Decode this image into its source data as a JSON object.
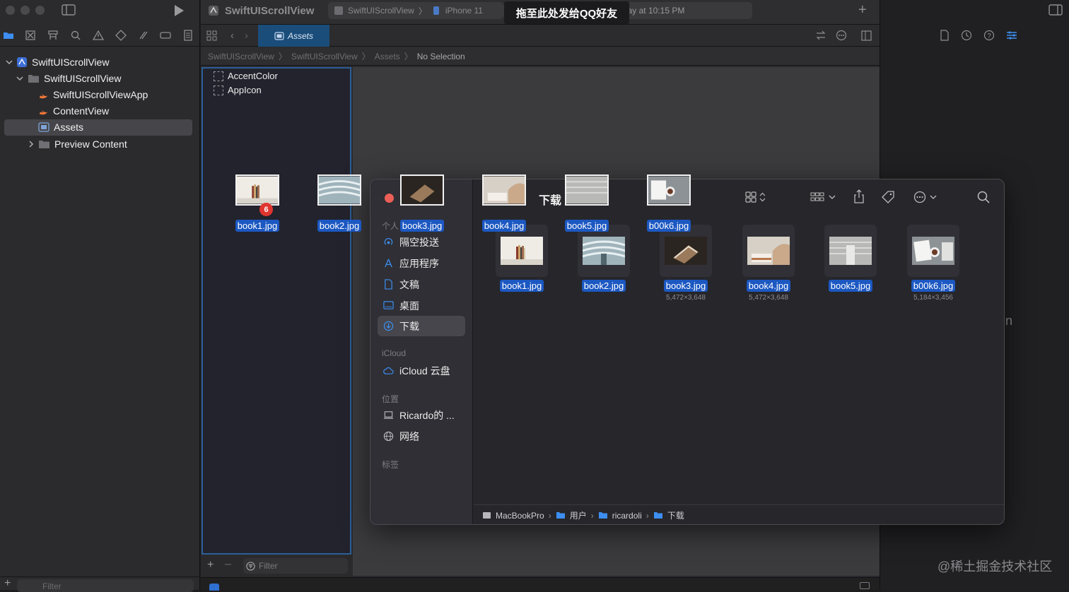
{
  "toast": "拖至此处发给QQ好友",
  "project": {
    "title": "SwiftUIScrollView"
  },
  "scheme": {
    "target": "SwiftUIScrollView",
    "device": "iPhone 11"
  },
  "status": {
    "text": "ew: Ready | Today at 10:15 PM"
  },
  "editor": {
    "tab_label": "Assets"
  },
  "jumpbar": {
    "crumbs": [
      "SwiftUIScrollView",
      "SwiftUIScrollView",
      "Assets",
      "No Selection"
    ]
  },
  "navigator": {
    "items": [
      {
        "label": "SwiftUIScrollView"
      },
      {
        "label": "SwiftUIScrollView"
      },
      {
        "label": "SwiftUIScrollViewApp"
      },
      {
        "label": "ContentView"
      },
      {
        "label": "Assets"
      },
      {
        "label": "Preview Content"
      }
    ],
    "filter_placeholder": "Filter"
  },
  "asset_catalog": {
    "items": [
      "AccentColor",
      "AppIcon"
    ],
    "filter_placeholder": "Filter"
  },
  "drag_items": {
    "files": [
      "book1.jpg",
      "book2.jpg",
      "book3.jpg",
      "book4.jpg",
      "book5.jpg",
      "b00k6.jpg"
    ],
    "count_badge": "6"
  },
  "finder": {
    "title": "下载",
    "sidebar": {
      "section_personal": "个人",
      "items": [
        "隔空投送",
        "应用程序",
        "文稿",
        "桌面",
        "下载"
      ],
      "section_icloud": "iCloud",
      "icloud_items": [
        "iCloud 云盘"
      ],
      "section_locations": "位置",
      "location_items": [
        "Ricardo的 ...",
        "网络"
      ],
      "section_tags": "标签"
    },
    "files": [
      {
        "name": "book1.jpg",
        "dims": ""
      },
      {
        "name": "book2.jpg",
        "dims": ""
      },
      {
        "name": "book3.jpg",
        "dims": "5,472×3,648"
      },
      {
        "name": "book4.jpg",
        "dims": "5,472×3,648"
      },
      {
        "name": "book5.jpg",
        "dims": ""
      },
      {
        "name": "b00k6.jpg",
        "dims": "5,184×3,456"
      }
    ],
    "path": [
      "MacBookPro",
      "用户",
      "ricardoli",
      "下载"
    ]
  },
  "inspector": {
    "partial_text": "n"
  },
  "watermark": "@稀土掘金技术社区",
  "colors": {
    "selection_blue": "#1c58c2",
    "close_red": "#ec5f57",
    "accent": "#2c5f96"
  }
}
